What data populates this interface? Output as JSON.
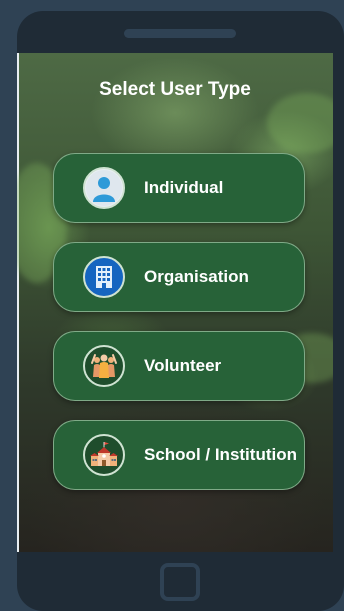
{
  "screen": {
    "title": "Select User Type"
  },
  "options": [
    {
      "label": "Individual",
      "icon": "person-avatar-icon"
    },
    {
      "label": "Organisation",
      "icon": "office-building-icon"
    },
    {
      "label": "Volunteer",
      "icon": "volunteers-group-icon"
    },
    {
      "label": "School / Institution",
      "icon": "school-building-icon"
    }
  ],
  "colors": {
    "button_bg": "#276238",
    "page_bg": "#2f4254",
    "phone_frame": "#1f2b36"
  }
}
